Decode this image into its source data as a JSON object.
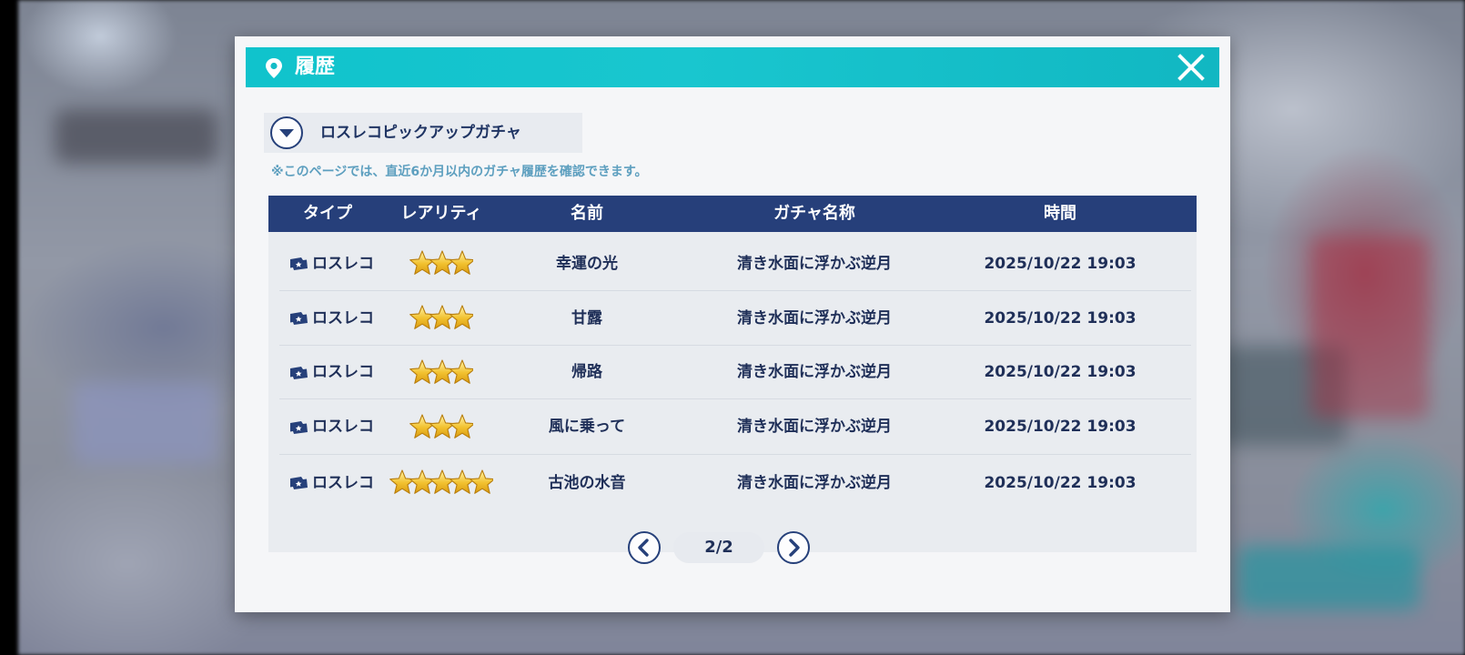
{
  "dialog": {
    "title": "履歴"
  },
  "gacha_selector": {
    "label": "ロスレコピックアップガチャ"
  },
  "notice": "※このページでは、直近6か月以内のガチャ履歴を確認できます。",
  "table": {
    "headers": [
      "タイプ",
      "レアリティ",
      "名前",
      "ガチャ名称",
      "時間"
    ],
    "rows": [
      {
        "type": "ロスレコ",
        "rarity": 3,
        "name": "幸運の光",
        "gacha": "清き水面に浮かぶ逆月",
        "time": "2025/10/22 19:03"
      },
      {
        "type": "ロスレコ",
        "rarity": 3,
        "name": "甘露",
        "gacha": "清き水面に浮かぶ逆月",
        "time": "2025/10/22 19:03"
      },
      {
        "type": "ロスレコ",
        "rarity": 3,
        "name": "帰路",
        "gacha": "清き水面に浮かぶ逆月",
        "time": "2025/10/22 19:03"
      },
      {
        "type": "ロスレコ",
        "rarity": 3,
        "name": "風に乗って",
        "gacha": "清き水面に浮かぶ逆月",
        "time": "2025/10/22 19:03"
      },
      {
        "type": "ロスレコ",
        "rarity": 5,
        "name": "古池の水音",
        "gacha": "清き水面に浮かぶ逆月",
        "time": "2025/10/22 19:03"
      }
    ]
  },
  "pager": {
    "page": "2/2"
  },
  "icons": {
    "header": "location-pin-icon",
    "close": "close-icon",
    "dropdown": "chevron-down-icon",
    "prev": "chevron-left-icon",
    "next": "chevron-right-icon",
    "type": "ticket-icon",
    "rarity": "star-icon"
  },
  "colors": {
    "header": "#10c3cc",
    "table_header": "#263f7a",
    "text_dark": "#1f2f58",
    "notice": "#5d9fbf",
    "star": "#f2c12e"
  }
}
